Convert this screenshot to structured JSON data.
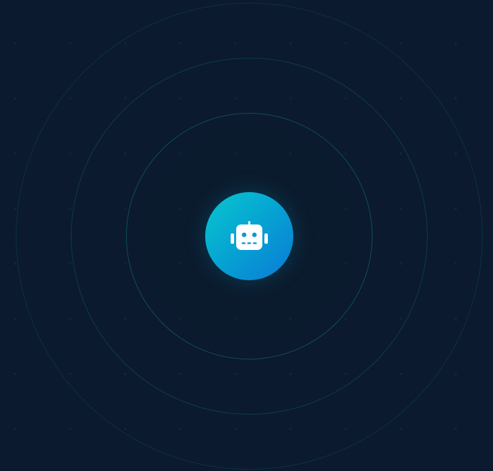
{
  "center_icon": {
    "name": "robot-icon",
    "gradient_start": "#08c6cf",
    "gradient_end": "#0a7ad6",
    "glyph_color": "#ffffff"
  },
  "rings": {
    "count": 3,
    "color": "#0f6b75"
  },
  "background": {
    "color": "#0b1a2e",
    "dot_color": "#13283d"
  }
}
